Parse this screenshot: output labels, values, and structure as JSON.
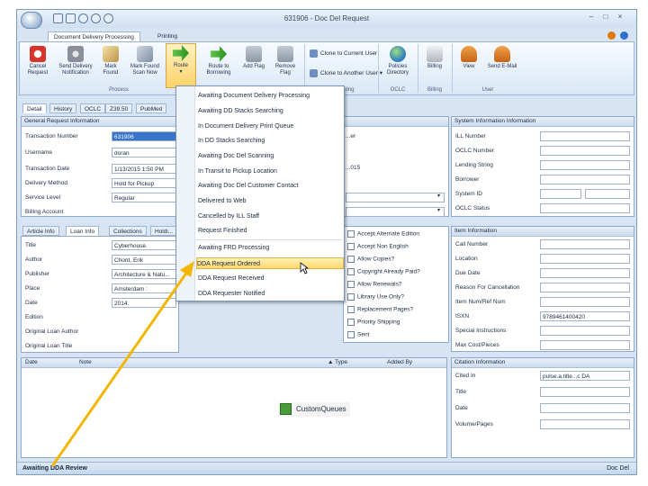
{
  "window": {
    "title": "631906 - Doc Del Request",
    "min_glyph": "–",
    "max_glyph": "□",
    "close_glyph": "×"
  },
  "tabs": [
    "Document Delivery Processing",
    "Printing"
  ],
  "ribbon": {
    "buttons": [
      "Cancel Request",
      "Send Delivery Notification",
      "Mark Found",
      "Mark Found Scan Now",
      "Route",
      "Route to Borrowing",
      "Add Flag",
      "Remove Flag"
    ],
    "process_group": "Process",
    "clone_current": "Clone to Current User",
    "clone_another": "Clone to Another User",
    "policies": "Policies Directory",
    "billing_btn": "Billing",
    "view": "View",
    "send_email": "Send E-Mail",
    "groups": {
      "tracking": "...ring",
      "oclc": "OCLC",
      "billing": "Billing",
      "user": "User"
    },
    "colors": {
      "cancel": "#d9342b",
      "gear": "#8a8f99",
      "route": "#3fae2a"
    }
  },
  "detail_tabs": [
    "Detail",
    "History",
    "OCLC",
    "Z39.50",
    "PubMed"
  ],
  "general": {
    "title": "General Request Information",
    "labels": [
      "Transaction Number",
      "Username",
      "Transaction Date",
      "Delivery Method",
      "Service Level",
      "Billing Account"
    ],
    "values": [
      "631906",
      "doran",
      "1/13/2015 1:50 PM",
      "Hold for Pickup",
      "Regular",
      ""
    ]
  },
  "mid_fragments": [
    "...er",
    "...015"
  ],
  "loan_tabs": [
    "Article Info",
    "Loan Info",
    "Collections",
    "Holdi..."
  ],
  "loan": {
    "labels": [
      "Title",
      "Author",
      "Publisher",
      "Place",
      "Date",
      "Edition",
      "Original Loan Author",
      "Original Loan Title"
    ],
    "values": [
      "Cyberhouse.",
      "Chont, Erik",
      "Architecture & Natu...",
      "Amsterdam :",
      "2014.",
      "",
      "",
      ""
    ]
  },
  "checks": [
    "Accept Alternate Edition",
    "Accept Non English",
    "Allow Copies?",
    "Copyright Already Paid?",
    "Allow Renewals?",
    "Library Use Only?",
    "Replacement Pages?",
    "Priority Shipping",
    "Sent"
  ],
  "system": {
    "title": "System Information Information",
    "labels": [
      "ILL Number",
      "OCLC Number",
      "Lending String",
      "Borrower",
      "System ID",
      "OCLC Status"
    ],
    "values": [
      "",
      "",
      "",
      "",
      "",
      ""
    ]
  },
  "item": {
    "title": "Item Information",
    "labels": [
      "Call Number",
      "Location",
      "Due Date",
      "Reason For Cancellation",
      "Item Num/Ref Num",
      "ISXN",
      "Special Instructions",
      "Max Cost/Pieces"
    ],
    "values": [
      "",
      "",
      "",
      "",
      "",
      "9789461400420",
      "",
      ""
    ]
  },
  "citation": {
    "title": "Citation Information",
    "labels": [
      "Cited In",
      "Title",
      "Date",
      "Volume/Pages"
    ],
    "values": [
      "pulse.a.title...c DA",
      "",
      "",
      ""
    ]
  },
  "notes": {
    "headers": [
      "Date",
      "Note",
      "Type",
      "Added By"
    ]
  },
  "custom_queues": "CustomQueues",
  "route_menu": {
    "items": [
      "Awaiting Document Delivery Processing",
      "Awaiting DD Stacks Searching",
      "In Document Delivery Print Queue",
      "In DD Stacks Searching",
      "Awaiting Doc Del Scanning",
      "In Transit to Pickup Location",
      "Awaiting Doc Del Customer Contact",
      "Delivered to Web",
      "Cancelled by ILL Staff",
      "Request Finished",
      "Awaiting FRD Processing",
      "DDA Request Ordered",
      "DDA Request Received",
      "DDA Requester Notified"
    ],
    "highlighted_index": 11
  },
  "status": {
    "left": "Awaiting DDA Review",
    "right": "Doc Del"
  },
  "arrow_color": "#f2b705"
}
